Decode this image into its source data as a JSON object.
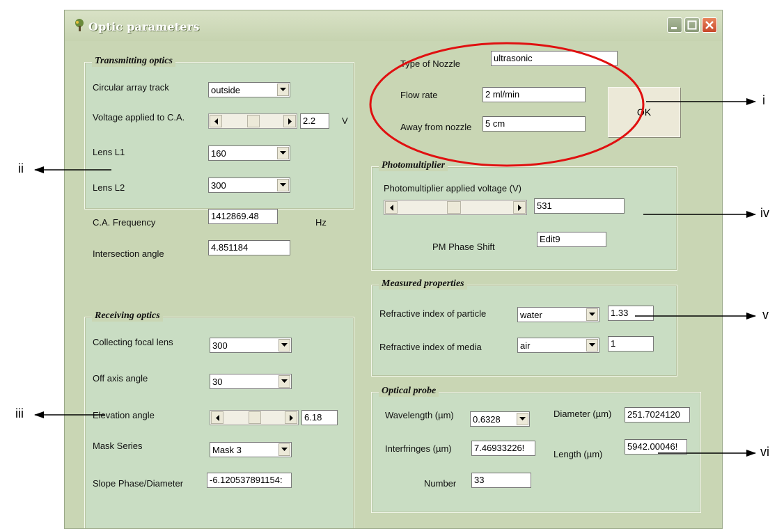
{
  "window": {
    "title": "Optic parameters"
  },
  "transmitting": {
    "legend": "Transmitting optics",
    "circular_label": "Circular array track",
    "circular_value": "outside",
    "voltage_label": "Voltage applied to C.A.",
    "voltage_value": "2.2",
    "voltage_unit": "V",
    "voltage_position": 0.5,
    "lens1_label": "Lens L1",
    "lens1_value": "160",
    "lens2_label": "Lens L2",
    "lens2_value": "300",
    "freq_label": "C.A. Frequency",
    "freq_value": "1412869.48",
    "freq_unit": "Hz",
    "angle_label": "Intersection angle",
    "angle_value": "4.851184"
  },
  "receiving": {
    "legend": "Receiving optics",
    "focal_label": "Collecting focal lens",
    "focal_value": "300",
    "offaxis_label": "Off axis angle",
    "offaxis_value": "30",
    "elevation_label": "Elevation angle",
    "elevation_value": "6.18",
    "elevation_position": 0.5,
    "mask_label": "Mask Series",
    "mask_value": "Mask 3",
    "slope_label": "Slope Phase/Diameter",
    "slope_value": "-6.120537891154:"
  },
  "nozzle": {
    "type_label": "Type of Nozzle",
    "type_value": "ultrasonic",
    "flow_label": "Flow rate",
    "flow_value": "2 ml/min",
    "away_label": "Away from nozzle",
    "away_value": "5 cm"
  },
  "ok_button": {
    "label": "OK"
  },
  "photomultiplier": {
    "legend": "Photomultiplier",
    "voltage_label": "Photomultiplier applied voltage  (V)",
    "voltage_value": "531",
    "voltage_position": 0.48,
    "phase_label": "PM Phase Shift",
    "phase_value": "Edit9"
  },
  "measured": {
    "legend": "Measured properties",
    "particle_label": "Refractive index of particle",
    "particle_value": "water",
    "particle_index": "1.33",
    "media_label": "Refractive index of media",
    "media_value": "air",
    "media_index": "1"
  },
  "probe": {
    "legend": "Optical probe",
    "wavelength_label": "Wavelength (µm)",
    "wavelength_value": "0.6328",
    "diameter_label": "Diameter (µm)",
    "diameter_value": "251.7024120",
    "interfringes_label": "Interfringes (µm)",
    "interfringes_value": "7.46933226!",
    "length_label": "Length (µm)",
    "length_value": "5942.00046!",
    "number_label": "Number",
    "number_value": "33"
  },
  "annotations": {
    "i": "i",
    "ii": "ii",
    "iii": "iii",
    "iv": "iv",
    "v": "v",
    "vi": "vi"
  },
  "colors": {
    "window_bg": "#c9d6b4",
    "group_bg": "#c9ddc3",
    "highlight_ellipse": "#e01010",
    "close_button": "#d4562f"
  }
}
